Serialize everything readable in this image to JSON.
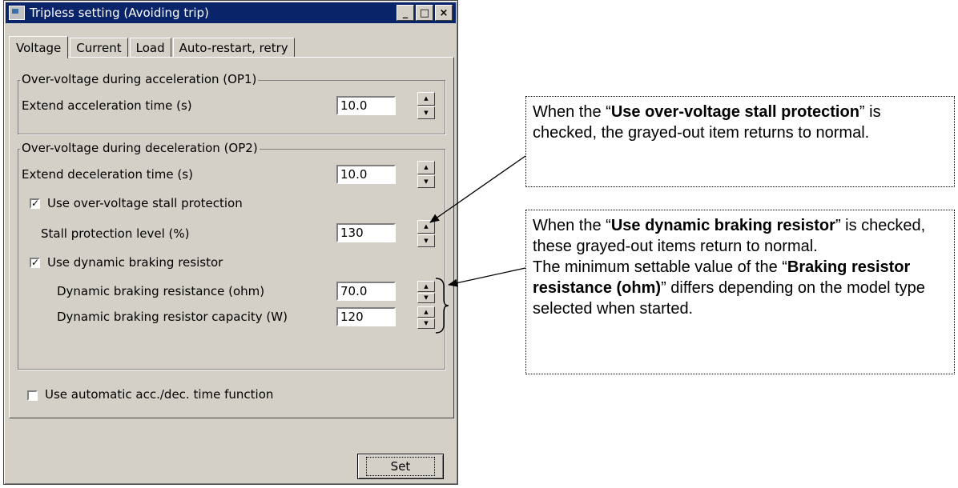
{
  "window": {
    "title": "Tripless setting (Avoiding trip)",
    "minimize_glyph": "_",
    "maximize_glyph": "□",
    "close_glyph": "×"
  },
  "tabs": [
    "Voltage",
    "Current",
    "Load",
    "Auto-restart, retry"
  ],
  "group1": {
    "title": "Over-voltage during acceleration (OP1)",
    "extend_label": "Extend acceleration time (s)",
    "extend_value": "10.0"
  },
  "group2": {
    "title": "Over-voltage during deceleration (OP2)",
    "extend_label": "Extend deceleration time (s)",
    "extend_value": "10.0",
    "stall_check_label": "Use over-voltage stall protection",
    "stall_checked": true,
    "stall_level_label": "Stall protection level (%)",
    "stall_level_value": "130",
    "dbr_check_label": "Use dynamic braking resistor",
    "dbr_checked": true,
    "dbr_resistance_label": "Dynamic braking resistance (ohm)",
    "dbr_resistance_value": "70.0",
    "dbr_capacity_label": "Dynamic braking resistor capacity (W)",
    "dbr_capacity_value": "120"
  },
  "auto_accdec_label": "Use automatic acc./dec. time function",
  "auto_accdec_checked": false,
  "set_button": "Set",
  "callout1": {
    "pre": "When the “",
    "bold": "Use over-voltage stall protection",
    "post": "” is checked, the grayed-out item returns to normal."
  },
  "callout2": {
    "pre": "When the “",
    "bold": "Use dynamic braking resistor",
    "post": "” is checked, these grayed-out items return to normal.",
    "line2_pre": "The minimum settable value of the “",
    "line2_bold": "Braking resistor resistance (ohm)",
    "line2_post": "” differs depending on the model type selected when started."
  }
}
